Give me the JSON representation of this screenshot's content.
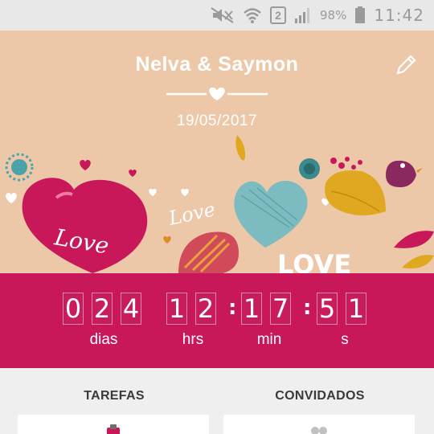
{
  "status_bar": {
    "sim_slot": "2",
    "battery": "98%",
    "time": "11:42"
  },
  "header": {
    "couple_name": "Nelva & Saymon",
    "date": "19/05/2017",
    "art_words": [
      "Love",
      "Love",
      "LOVE"
    ]
  },
  "countdown": {
    "days": [
      "0",
      "2",
      "4"
    ],
    "hours": [
      "1",
      "2"
    ],
    "minutes": [
      "1",
      "7"
    ],
    "seconds": [
      "5",
      "1"
    ],
    "separator": ":",
    "labels": {
      "days": "dias",
      "hours": "hrs",
      "minutes": "min",
      "seconds": "s"
    }
  },
  "cards": {
    "tasks": {
      "title": "TAREFAS",
      "icon": "clipboard-icon"
    },
    "guests": {
      "title": "CONVIDADOS",
      "icon": "people-icon"
    }
  },
  "colors": {
    "header_bg": "#edc8a8",
    "countdown_bg": "#c8185a",
    "card_bg": "#ffffff"
  }
}
